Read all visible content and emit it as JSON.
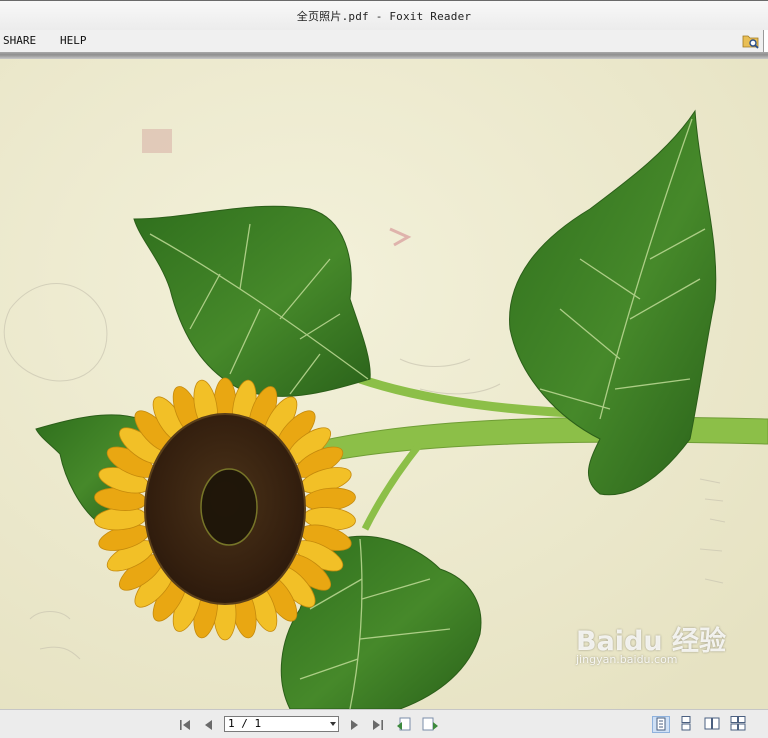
{
  "window": {
    "title": "全页照片.pdf - Foxit Reader"
  },
  "menu": {
    "items": [
      {
        "label": "SHARE"
      },
      {
        "label": "HELP"
      }
    ]
  },
  "icons": {
    "search_folder": "folder-search-icon",
    "first_page": "first-page-icon",
    "prev_page": "prev-page-icon",
    "next_page": "next-page-icon",
    "last_page": "last-page-icon",
    "prev_view": "previous-view-icon",
    "next_view": "next-view-icon",
    "single_page": "single-page-view-icon",
    "continuous": "continuous-view-icon",
    "facing": "facing-view-icon",
    "continuous_facing": "continuous-facing-view-icon"
  },
  "navigation": {
    "page_value": "1 / 1"
  },
  "watermark": {
    "logo": "Baidu 经验",
    "url": "jingyan.baidu.com"
  },
  "colors": {
    "paper": "#eeebd0",
    "leaf": "#3d7f24",
    "petal": "#f0b81a",
    "center": "#3a2412",
    "stem": "#8cbf48",
    "active_view": "#cfe0f5"
  }
}
